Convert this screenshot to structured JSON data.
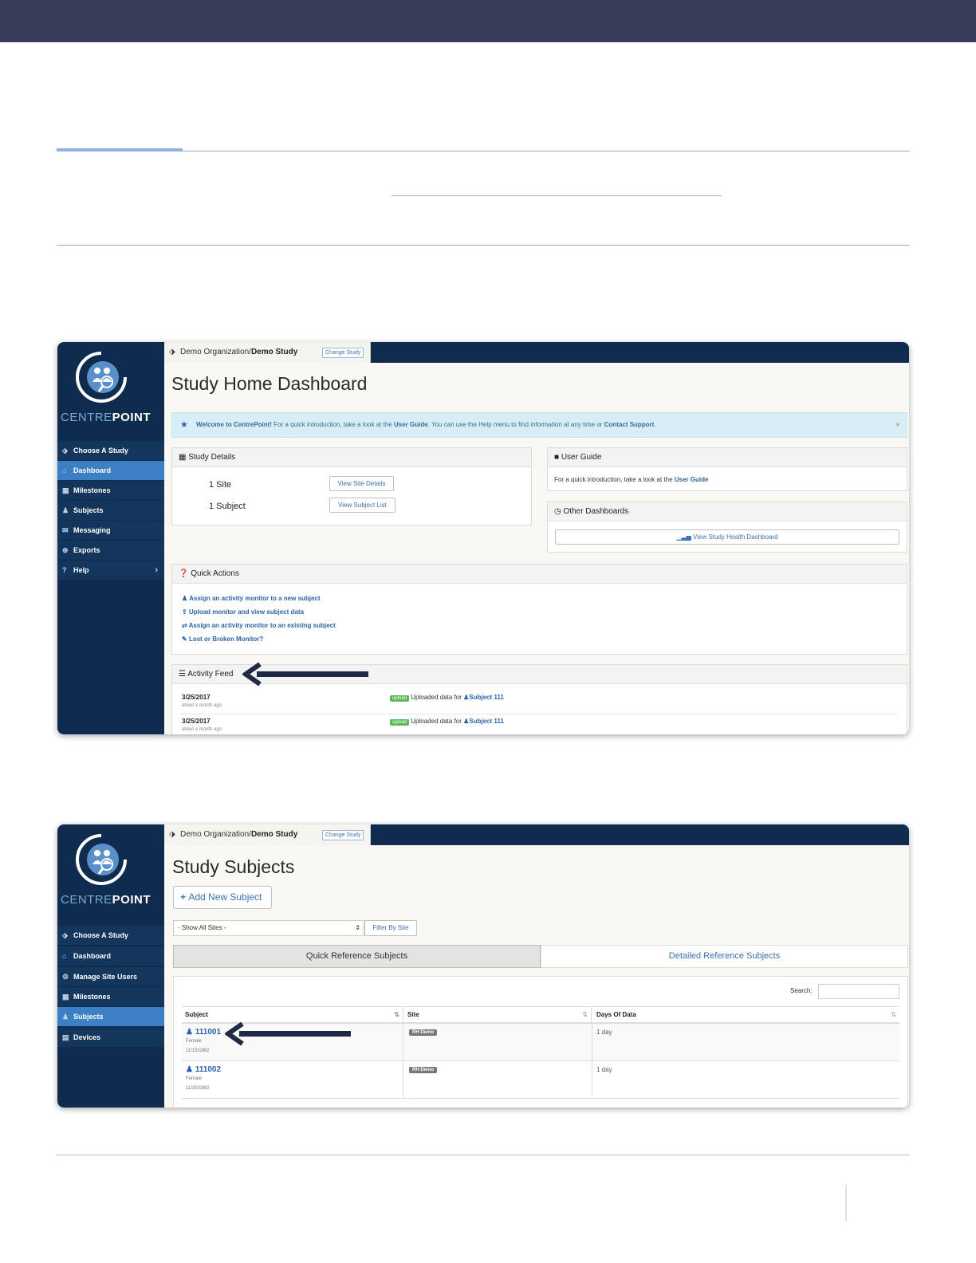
{
  "shot1": {
    "breadcrumb": {
      "org": "Demo Organization/",
      "study": "Demo Study",
      "change": "Change Study"
    },
    "logo": {
      "part1": "CENTRE",
      "part2": "POINT"
    },
    "nav": [
      {
        "label": "Choose A Study",
        "icon": "tag-icon"
      },
      {
        "label": "Dashboard",
        "icon": "home-icon",
        "active": true
      },
      {
        "label": "Milestones",
        "icon": "calendar-icon"
      },
      {
        "label": "Subjects",
        "icon": "user-icon"
      },
      {
        "label": "Messaging",
        "icon": "envelope-icon"
      },
      {
        "label": "Exports",
        "icon": "export-icon"
      },
      {
        "label": "Help",
        "icon": "question-icon"
      }
    ],
    "title": "Study Home Dashboard",
    "alert": {
      "strong": "Welcome to CentrePoint!",
      "text1": " For a quick introduction, take a look at the ",
      "link1": "User Guide",
      "text2": ". You can use the Help menu to find information at any time or ",
      "link2": "Contact Support",
      "text3": ".",
      "close": "×"
    },
    "study_details": {
      "header": "Study Details",
      "site_count": "1 Site",
      "subject_count": "1 Subject",
      "site_button": "View Site Details",
      "subject_button": "View Subject List"
    },
    "user_guide": {
      "header": "User Guide",
      "text": "For a quick introduction, take a look at the ",
      "link": "User Guide"
    },
    "other_dashboards": {
      "header": "Other Dashboards",
      "button": "View Study Health Dashboard"
    },
    "quick_actions": {
      "header": "Quick Actions",
      "items": [
        "Assign an activity monitor to a new subject",
        "Upload monitor and view subject data",
        "Assign an activity monitor to an existing subject",
        "Lost or Broken Monitor?"
      ]
    },
    "activity_feed": {
      "header": "Activity Feed",
      "rows": [
        {
          "date": "3/25/2017",
          "ago": "about a month ago",
          "badge": "upload",
          "text": "Uploaded data for ",
          "subject": "Subject 111"
        },
        {
          "date": "3/25/2017",
          "ago": "about a month ago",
          "badge": "upload",
          "text": "Uploaded data for ",
          "subject": "Subject 111"
        }
      ]
    }
  },
  "shot2": {
    "breadcrumb": {
      "org": "Demo Organization/",
      "study": "Demo Study",
      "change": "Change Study"
    },
    "logo": {
      "part1": "CENTRE",
      "part2": "POINT"
    },
    "nav": [
      {
        "label": "Choose A Study",
        "icon": "tag-icon"
      },
      {
        "label": "Dashboard",
        "icon": "home-icon"
      },
      {
        "label": "Manage Site Users",
        "icon": "gear-icon"
      },
      {
        "label": "Milestones",
        "icon": "calendar-icon"
      },
      {
        "label": "Subjects",
        "icon": "user-icon",
        "active": true
      },
      {
        "label": "Devices",
        "icon": "device-icon"
      }
    ],
    "title": "Study Subjects",
    "add_button": "Add New Subject",
    "site_select": "- Show All Sites -",
    "filter_button": "Filter By Site",
    "tabs": [
      "Quick Reference Subjects",
      "Detailed Reference Subjects"
    ],
    "search_label": "Search:",
    "columns": [
      "Subject",
      "Site",
      "Days Of Data"
    ],
    "rows": [
      {
        "id": "111001",
        "sex": "Female",
        "dob": "11/15/1982",
        "site": "RH Demo",
        "days": "1 day"
      },
      {
        "id": "111002",
        "sex": "Female",
        "dob": "11/30/1982",
        "site": "RH Demo",
        "days": "1 day"
      }
    ]
  }
}
